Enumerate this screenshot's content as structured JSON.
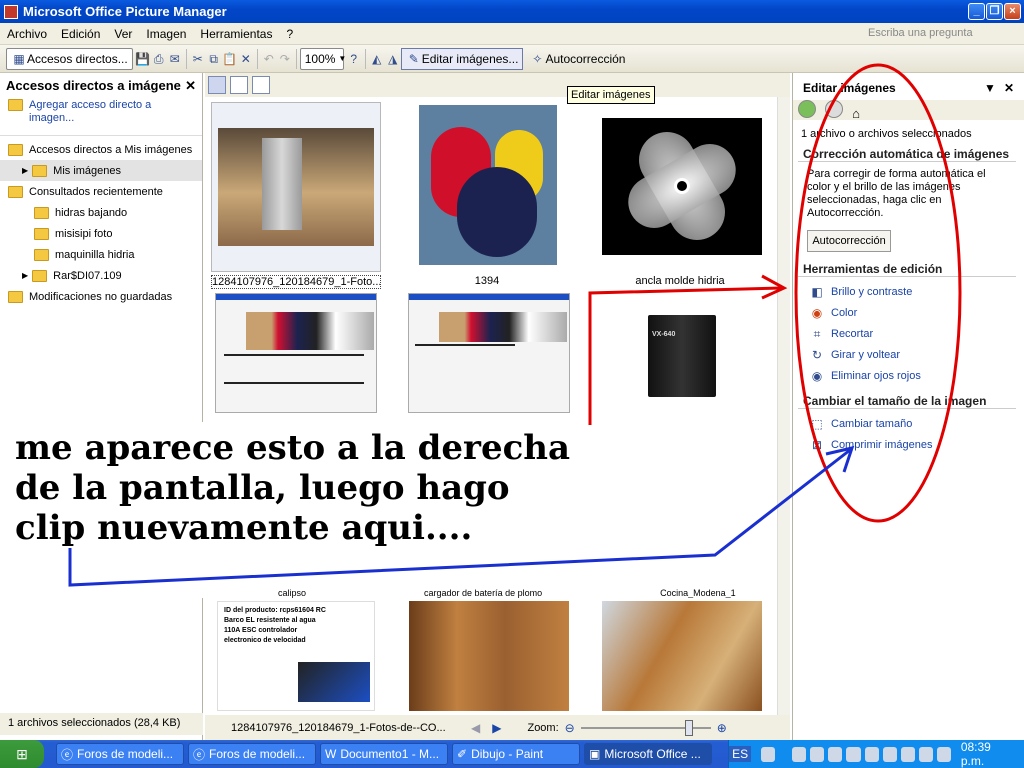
{
  "window": {
    "title": "Microsoft Office Picture Manager"
  },
  "menu": {
    "items": [
      "Archivo",
      "Edición",
      "Ver",
      "Imagen",
      "Herramientas",
      "?"
    ],
    "ask_placeholder": "Escriba una pregunta"
  },
  "toolbar": {
    "shortcuts_label": "Accesos directos...",
    "zoom_value": "100%",
    "edit_images_label": "Editar imágenes...",
    "autocorrect_label": "Autocorrección"
  },
  "tooltip": "Editar imágenes",
  "left_pane": {
    "title": "Accesos directos a imágene",
    "add_shortcut": "Agregar acceso directo a imagen...",
    "tree": [
      {
        "label": "Accesos directos a Mis imágenes",
        "level": 0
      },
      {
        "label": "Mis imágenes",
        "level": 1,
        "selected": true
      },
      {
        "label": "Consultados recientemente",
        "level": 0
      },
      {
        "label": "hidras bajando",
        "level": 1
      },
      {
        "label": "misisipi foto",
        "level": 1
      },
      {
        "label": "maquinilla hidria",
        "level": 1
      },
      {
        "label": "Rar$DI07.109",
        "level": 1
      },
      {
        "label": "Modificaciones no guardadas",
        "level": 0
      }
    ],
    "status": "1 archivos seleccionados (28,4 KB)"
  },
  "gallery": {
    "captions": [
      "1284107976_120184679_1-Foto...",
      "1394",
      "ancla molde hidria",
      "",
      "",
      "",
      "",
      "",
      "",
      "",
      "",
      ""
    ],
    "partial_captions": [
      "calipso",
      "cargador de batería de plomo",
      "Cocina_Modena_1"
    ],
    "doc_thumb_text": "ID del producto: rcps61604 RC Barco EL resistente al agua 110A ESC controlador electronico de velocidad",
    "battery_label": "VX-640",
    "selected_filename": "1284107976_120184679_1-Fotos-de--CO...",
    "zoom_label": "Zoom:"
  },
  "annotation": {
    "text_lines": [
      "me aparece esto a la derecha",
      "de la pantalla, luego hago",
      "clip nuevamente aqui...."
    ]
  },
  "right_pane": {
    "title": "Editar imágenes",
    "selected_info": "1 archivo o archivos seleccionados",
    "auto_section": "Corrección automática de imágenes",
    "auto_text": "Para corregir de forma automática el color y el brillo de las imágenes seleccionadas, haga clic en Autocorrección.",
    "auto_button": "Autocorrección",
    "tools_section": "Herramientas de edición",
    "tools": [
      {
        "label": "Brillo y contraste",
        "icon": "brightness-icon"
      },
      {
        "label": "Color",
        "icon": "color-wheel-icon"
      },
      {
        "label": "Recortar",
        "icon": "crop-icon"
      },
      {
        "label": "Girar y voltear",
        "icon": "rotate-icon"
      },
      {
        "label": "Eliminar ojos rojos",
        "icon": "red-eye-icon"
      }
    ],
    "resize_section": "Cambiar el tamaño de la imagen",
    "resize_tools": [
      {
        "label": "Cambiar tamaño",
        "icon": "resize-icon"
      },
      {
        "label": "Comprimir imágenes",
        "icon": "compress-icon"
      }
    ]
  },
  "taskbar": {
    "tasks": [
      "Foros de modeli...",
      "Foros de modeli...",
      "Documento1 - M...",
      "Dibujo - Paint",
      "Microsoft Office ..."
    ],
    "lang": "ES",
    "clock": "08:39 p.m."
  },
  "colors": {
    "annotation_red": "#e00000",
    "annotation_blue": "#1a2fd0",
    "xp_blue": "#0043c0"
  }
}
